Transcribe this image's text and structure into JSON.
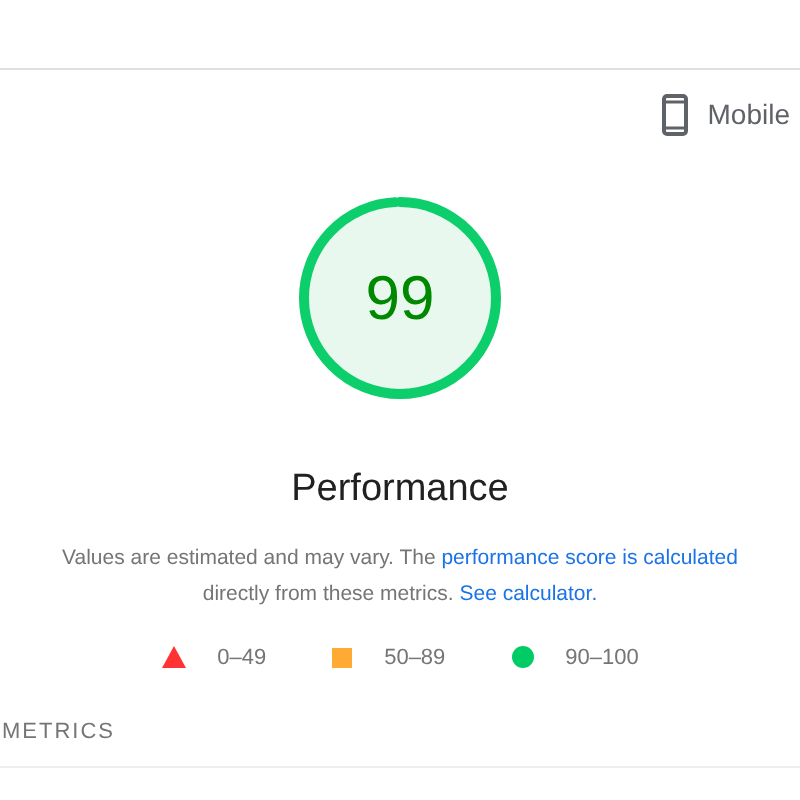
{
  "device": {
    "label": "Mobile"
  },
  "gauge": {
    "score": "99",
    "title": "Performance"
  },
  "description": [
    {
      "kind": "text",
      "text": "Values are estimated and may vary. The "
    },
    {
      "kind": "link",
      "text": "performance score is calculated"
    },
    {
      "kind": "text",
      "text": " directly from these metrics. "
    },
    {
      "kind": "link",
      "text": "See calculator."
    }
  ],
  "legend": [
    {
      "kind": "triangle",
      "label": "0–49",
      "color": "#ff3333"
    },
    {
      "kind": "square",
      "label": "50–89",
      "color": "#ffaa33"
    },
    {
      "kind": "circle",
      "label": "90–100",
      "color": "#00cc66"
    }
  ],
  "section": {
    "title": "METRICS"
  }
}
